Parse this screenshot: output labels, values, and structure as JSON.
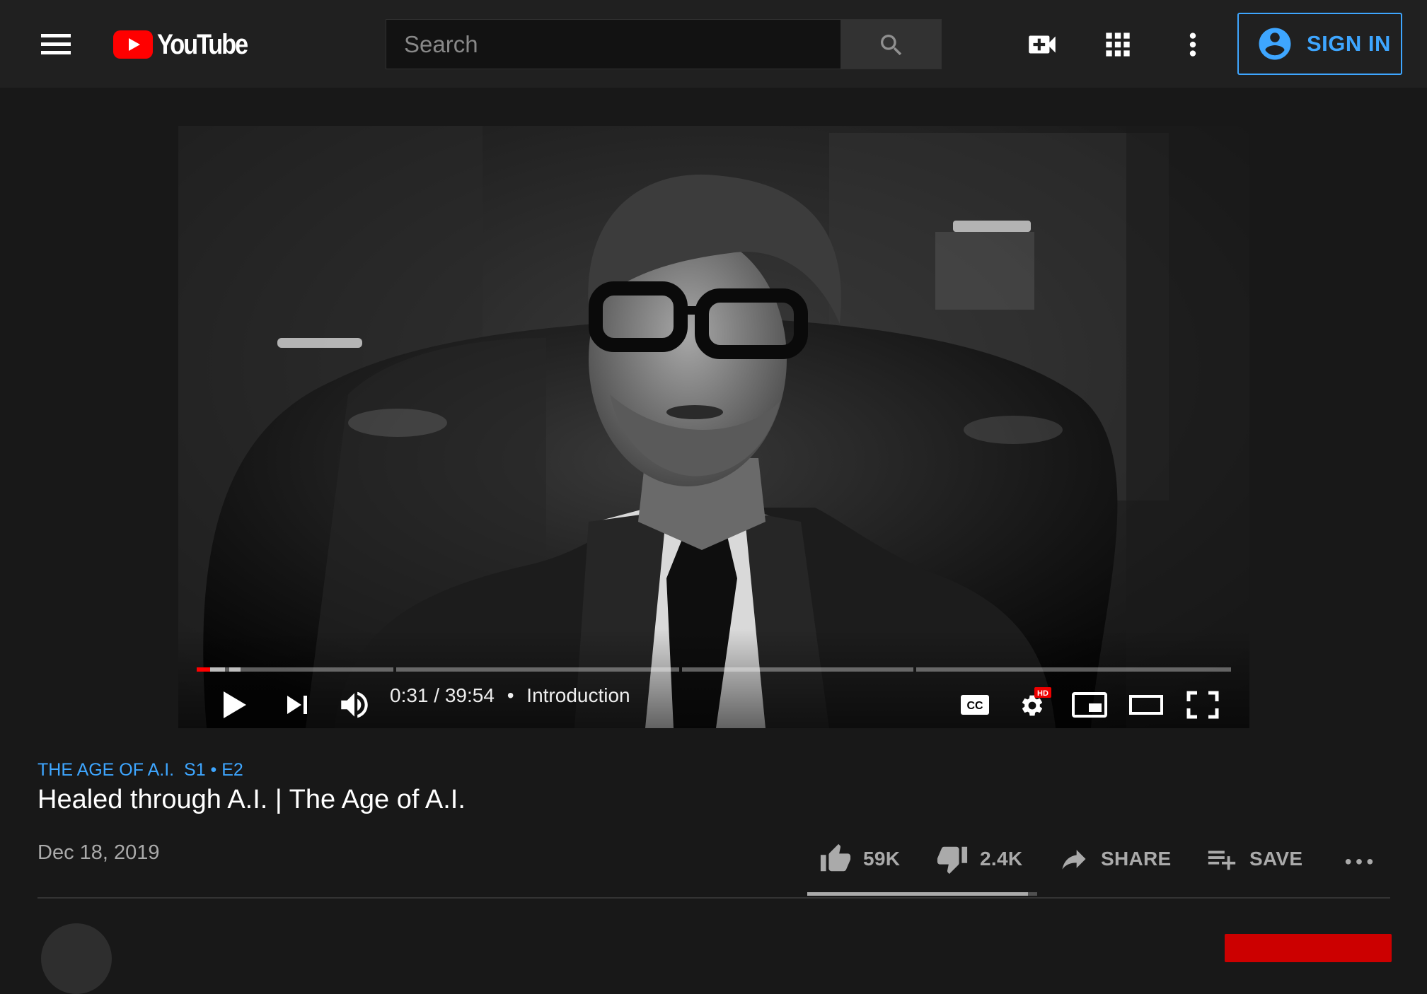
{
  "masthead": {
    "logo_text": "YouTube",
    "search_placeholder": "Search",
    "signin_label": "SIGN IN",
    "icons": [
      "menu-icon",
      "search-icon",
      "create-video-icon",
      "apps-icon",
      "more-vert-icon",
      "account-circle-icon"
    ],
    "accent_color": "#3ea6ff"
  },
  "player": {
    "current_time": "0:31",
    "duration": "39:54",
    "time_separator": "/",
    "chapter_separator": "•",
    "chapter": "Introduction",
    "progress_played_fraction": 0.013,
    "hd_badge": "HD",
    "cc_label": "CC",
    "progress_color": "#ff0000"
  },
  "video": {
    "series_name": "THE AGE OF A.I.",
    "episode": "S1 • E2",
    "title": "Healed through A.I. | The Age of A.I.",
    "date": "Dec 18, 2019"
  },
  "actions": {
    "likes": "59K",
    "dislikes": "2.4K",
    "share_label": "SHARE",
    "save_label": "SAVE",
    "like_fraction": 0.96
  }
}
